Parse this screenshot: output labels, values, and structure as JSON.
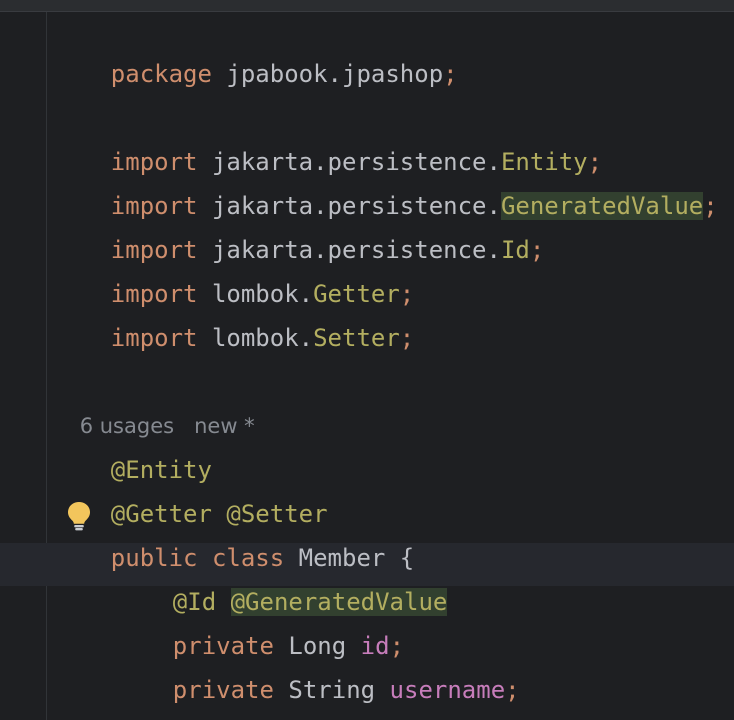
{
  "editor": {
    "lines": {
      "package_kw": "package",
      "package_name": " jpabook.jpashop",
      "semi": ";",
      "import_kw": "import",
      "imp1_pkg": " jakarta.persistence.",
      "imp1_cls": "Entity",
      "imp2_pkg": " jakarta.persistence.",
      "imp2_cls": "GeneratedValue",
      "imp3_pkg": " jakarta.persistence.",
      "imp3_cls": "Id",
      "imp4_pkg": " lombok.",
      "imp4_cls": "Getter",
      "imp5_pkg": " lombok.",
      "imp5_cls": "Setter",
      "ann_entity": "@Entity",
      "ann_getter": "@Getter",
      "ann_setter": "@Setter",
      "public_kw": "public",
      "class_kw": "class",
      "class_name": " Member {",
      "ann_id": "@Id",
      "ann_generated": "@GeneratedValue",
      "private_kw": "private",
      "type_long": " Long ",
      "field_id": "id",
      "type_string": " String ",
      "field_username": "username",
      "close_brace": "}"
    },
    "inlay": {
      "usages": "6 usages",
      "new_marker": "new *"
    },
    "icons": {
      "intention": "lightbulb-icon"
    },
    "colors": {
      "background": "#1e1f22",
      "keyword": "#cf8e6d",
      "annotation": "#b3ae60",
      "field": "#c77dbb",
      "text": "#bcbec4",
      "inlay": "#868a91",
      "usage_highlight": "#32402f",
      "current_line": "#26282e",
      "bulb": "#f2c55c"
    }
  }
}
